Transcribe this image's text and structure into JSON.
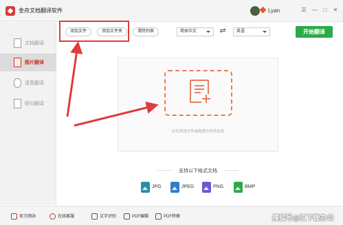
{
  "window": {
    "title": "金舟文档翻译软件",
    "username": "Lyan",
    "controls": [
      "☰",
      "—",
      "□",
      "✕"
    ]
  },
  "sidebar": {
    "items": [
      {
        "label": "文档翻译",
        "active": false
      },
      {
        "label": "图片翻译",
        "active": true
      },
      {
        "label": "语音翻译",
        "active": false
      },
      {
        "label": "短句翻译",
        "active": false
      }
    ]
  },
  "toolbar": {
    "add_file": "添加文件",
    "add_folder": "添加文件夹",
    "clear_list": "清除列表",
    "source_lang": "简体中文",
    "target_lang": "英语",
    "swap_icon": "⇌",
    "start": "开始翻译"
  },
  "dropzone": {
    "hint": "点击添加文件或拖拽文件到此处"
  },
  "formats": {
    "title": "支持以下格式文档",
    "items": [
      {
        "label": "JPG",
        "color": "#2a8fa8"
      },
      {
        "label": "JPEG",
        "color": "#2f7fc6"
      },
      {
        "label": "PNG",
        "color": "#6a5acd"
      },
      {
        "label": "BMP",
        "color": "#2ca94b"
      }
    ]
  },
  "bottom": {
    "items": [
      "官方网站",
      "在线客服",
      "文字识别",
      "PDF编辑",
      "PDF转换"
    ]
  },
  "watermark": "搜狐号@江下做办公",
  "colors": {
    "accent_red": "#c0392b",
    "start_green": "#2ca94b",
    "dashed_orange": "#e67e5a",
    "annotation_red": "#e03a3a"
  }
}
